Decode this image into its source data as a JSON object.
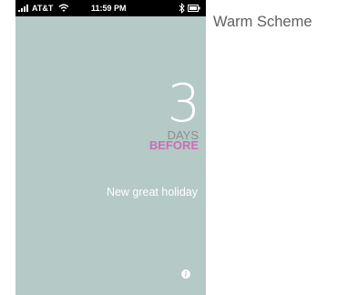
{
  "scheme": {
    "title": "Warm Scheme"
  },
  "status_bar": {
    "carrier": "AT&T",
    "time": "11:59 PM",
    "signal_icon": "signal-strength-icon",
    "wifi_icon": "wifi-icon",
    "bluetooth_icon": "bluetooth-icon",
    "battery_icon": "battery-icon"
  },
  "countdown": {
    "number": "3",
    "unit": "DAYS",
    "relation": "BEFORE",
    "event_name": "New great holiday"
  },
  "footer": {
    "info_icon": "info-icon"
  },
  "colors": {
    "background": "#b5c9c6",
    "status_bar": "#000000",
    "primary_text": "#ffffff",
    "days_text": "#8a8f8e",
    "before_text": "#c86fb5",
    "scheme_title": "#5f5f5f"
  }
}
